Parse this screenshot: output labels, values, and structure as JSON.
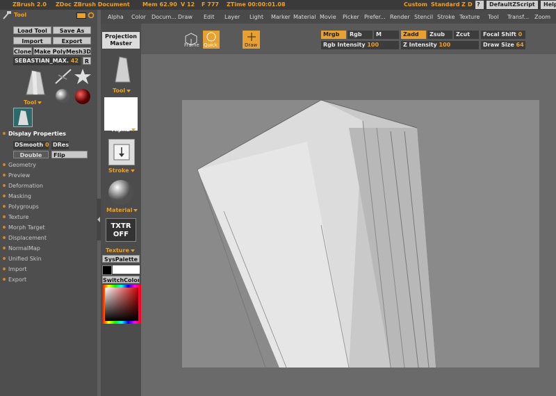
{
  "titlebar": {
    "app": "ZBrush 2.0",
    "doc1": "ZDoc",
    "doc2": "ZBrush Document",
    "mem": "Mem 62.90",
    "v": "V 12",
    "f": "F 777",
    "ztime": "ZTime 00:00:01.08",
    "custom": "Custom",
    "standard": "Standard",
    "z": "Z",
    "d": "D",
    "help_q": "?",
    "defaultzscript": "DefaultZScript",
    "help": "Help"
  },
  "menu": [
    "Alpha",
    "Color",
    "Docum...",
    "Draw",
    "Edit",
    "Layer",
    "Light",
    "Marker",
    "Material",
    "Movie",
    "Picker",
    "Prefer...",
    "Render",
    "Stencil",
    "Stroke",
    "Texture",
    "Tool",
    "Transf...",
    "Zoom"
  ],
  "toolpanel": {
    "title": "Tool",
    "load_tool": "Load Tool",
    "save_as": "Save As",
    "import": "Import",
    "export": "Export",
    "clone": "Clone",
    "make_polymesh": "Make PolyMesh3D",
    "tool_name": "SEBASTIAN_MAX.",
    "tool_count": "42",
    "r_btn": "R",
    "tool_label": "Tool",
    "display_props": "Display Properties",
    "dsmooth": "DSmooth",
    "dsmooth_val": "0",
    "dres": "DRes",
    "double": "Double",
    "flip": "Flip",
    "sections": [
      "Geometry",
      "Preview",
      "Deformation",
      "Masking",
      "Polygroups",
      "Texture",
      "Morph Target",
      "Displacement",
      "NormalMap",
      "Unified Skin",
      "Import",
      "Export"
    ]
  },
  "col2": {
    "projection": "Projection",
    "master": "Master",
    "tool": "Tool",
    "alpha": "Alpha",
    "stroke": "Stroke",
    "material": "Material",
    "txtr1": "TXTR",
    "txtr2": "OFF",
    "texture": "Texture",
    "syspalette": "SysPalette",
    "switchcolor": "SwitchColor"
  },
  "toolbar": {
    "frame": "Frame",
    "quick": "Quick",
    "draw": "Draw",
    "mrgb": "Mrgb",
    "rgb": "Rgb",
    "m": "M",
    "zadd": "Zadd",
    "zsub": "Zsub",
    "zcut": "Zcut",
    "focal_shift_label": "Focal Shift",
    "focal_shift_val": "0",
    "rgb_intensity_label": "Rgb Intensity",
    "rgb_intensity_val": "100",
    "z_intensity_label": "Z Intensity",
    "z_intensity_val": "100",
    "draw_size_label": "Draw Size",
    "draw_size_val": "64"
  },
  "colors": {
    "accent": "#f0a020",
    "panel": "#4e4e4e",
    "viewport": "#6a6a6a",
    "document": "#8a8a8a"
  }
}
